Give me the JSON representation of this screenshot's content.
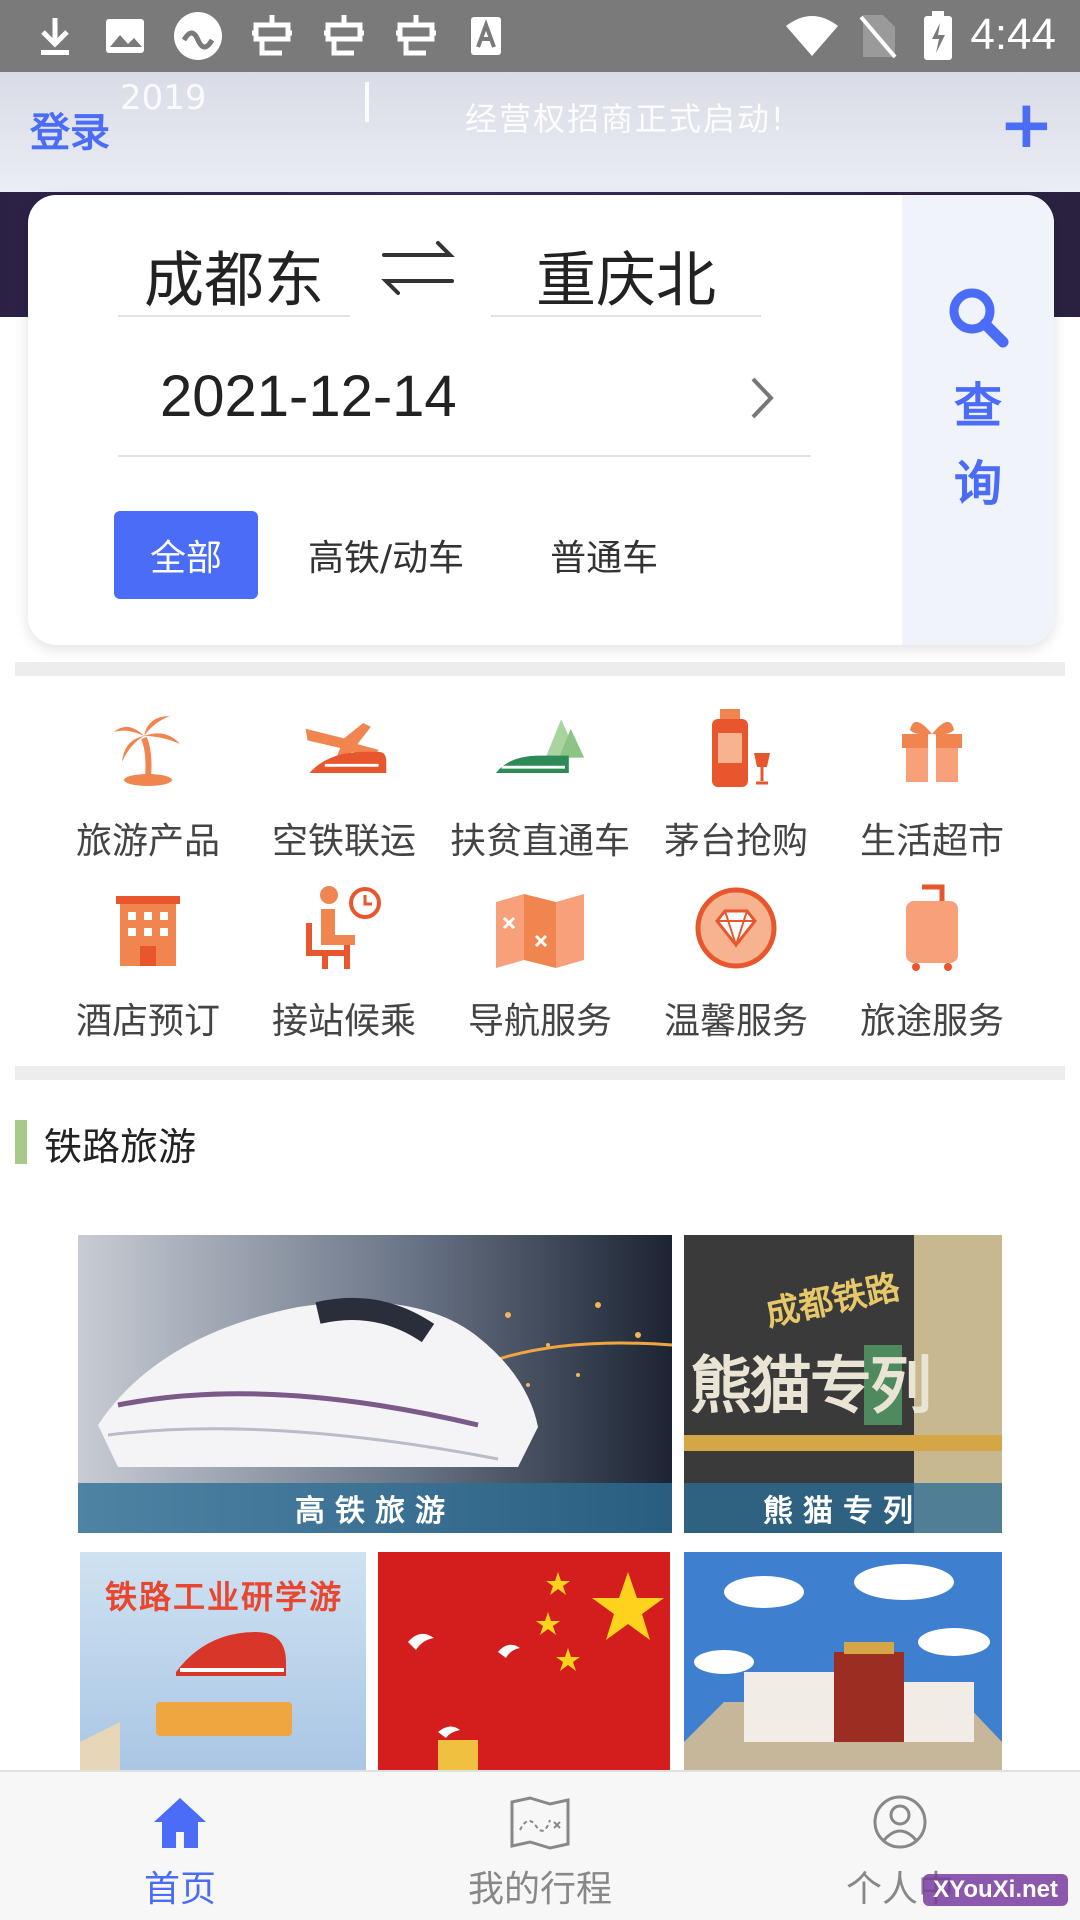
{
  "status_bar": {
    "time": "4:44"
  },
  "banner": {
    "ghost_year": "2019",
    "ghost_text": "经营权招商正式启动!",
    "login_label": "登录",
    "add_label": "+"
  },
  "search": {
    "from_station": "成都东",
    "to_station": "重庆北",
    "date": "2021-12-14",
    "search_label": "查询",
    "filters": [
      {
        "label": "全部",
        "active": true
      },
      {
        "label": "高铁/动车",
        "active": false
      },
      {
        "label": "普通车",
        "active": false
      }
    ]
  },
  "services": [
    {
      "label": "旅游产品",
      "icon": "palm-tree-icon"
    },
    {
      "label": "空铁联运",
      "icon": "plane-train-icon"
    },
    {
      "label": "扶贫直通车",
      "icon": "train-mountain-icon"
    },
    {
      "label": "茅台抢购",
      "icon": "liquor-bottle-icon"
    },
    {
      "label": "生活超市",
      "icon": "gift-box-icon"
    },
    {
      "label": "酒店预订",
      "icon": "hotel-icon"
    },
    {
      "label": "接站候乘",
      "icon": "waiting-seat-icon"
    },
    {
      "label": "导航服务",
      "icon": "map-icon"
    },
    {
      "label": "温馨服务",
      "icon": "diamond-icon"
    },
    {
      "label": "旅途服务",
      "icon": "luggage-icon"
    }
  ],
  "section": {
    "title": "铁路旅游"
  },
  "tiles": {
    "hsr_caption": "高铁旅游",
    "panda_caption": "熊猫专列",
    "panda_big_text": "熊猫专列",
    "panda_small_text": "成都铁路",
    "study_text": "铁路工业研学游"
  },
  "bottom_nav": [
    {
      "label": "首页",
      "active": true,
      "icon": "home-icon"
    },
    {
      "label": "我的行程",
      "active": false,
      "icon": "route-map-icon"
    },
    {
      "label": "个人中",
      "active": false,
      "icon": "user-icon"
    }
  ],
  "watermark": "XYouXi.net",
  "colors": {
    "accent": "#4a6cf7",
    "icon_orange": "#f08550",
    "caption_bg": "#2d6e96"
  }
}
